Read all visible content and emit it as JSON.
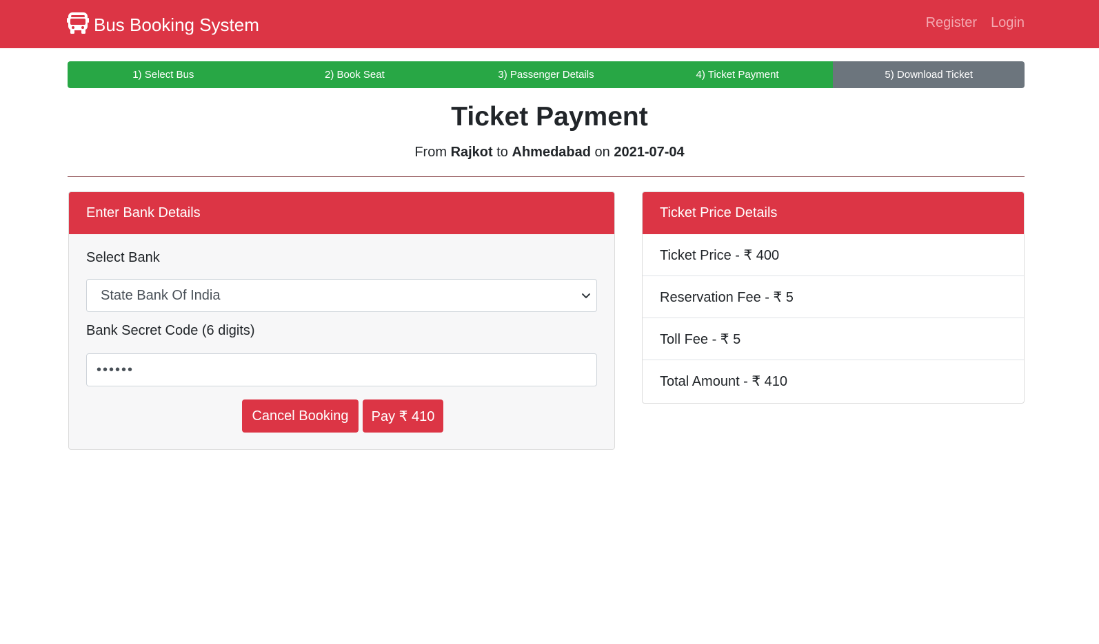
{
  "navbar": {
    "brand": "Bus Booking System",
    "brand_icon": "bus-icon",
    "links": [
      "Register",
      "Login"
    ]
  },
  "steps": [
    {
      "label": "1) Select Bus",
      "status": "done"
    },
    {
      "label": "2) Book Seat",
      "status": "done"
    },
    {
      "label": "3) Passenger Details",
      "status": "done"
    },
    {
      "label": "4) Ticket Payment",
      "status": "done"
    },
    {
      "label": "5) Download Ticket",
      "status": "pending"
    }
  ],
  "page": {
    "title": "Ticket Payment",
    "route": {
      "from_word": "From",
      "from": "Rajkot",
      "to_word": "to",
      "to": "Ahmedabad",
      "on_word": "on",
      "date": "2021-07-04"
    }
  },
  "bank_form": {
    "header": "Enter Bank Details",
    "bank_label": "Select Bank",
    "bank_selected": "State Bank Of India",
    "code_label": "Bank Secret Code (6 digits)",
    "code_value": "••••••",
    "cancel_button": "Cancel Booking",
    "pay_button": "Pay ₹ 410"
  },
  "price_details": {
    "header": "Ticket Price Details",
    "rows": [
      "Ticket Price - ₹ 400",
      "Reservation Fee - ₹ 5",
      "Toll Fee - ₹ 5",
      "Total Amount - ₹ 410"
    ]
  },
  "colors": {
    "primary": "#dc3545",
    "success": "#28a745",
    "secondary": "#6c757d"
  }
}
